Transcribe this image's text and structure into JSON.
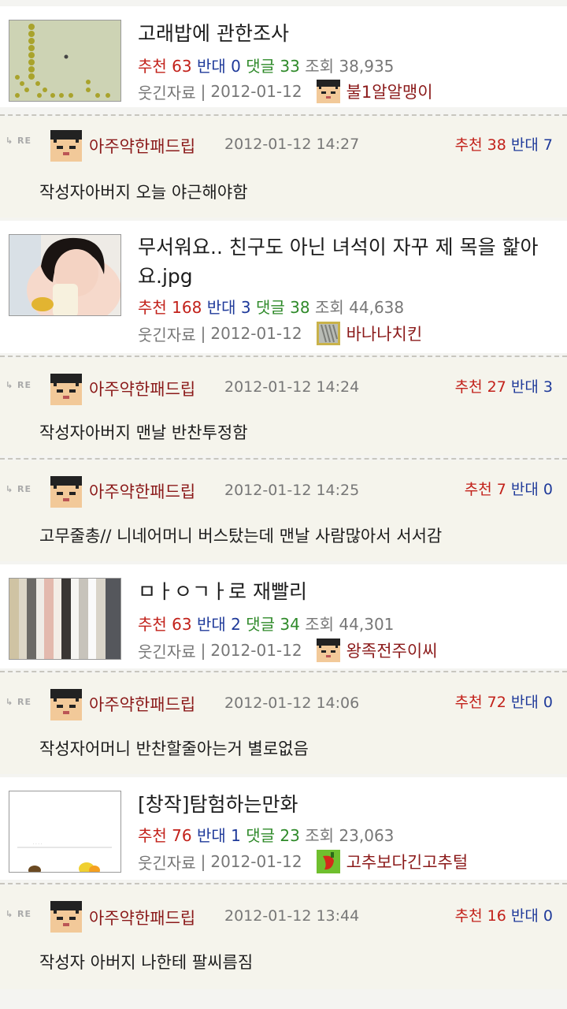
{
  "labels": {
    "recommend": "추천",
    "oppose": "반대",
    "comments": "댓글",
    "views": "조회",
    "re": "RE"
  },
  "colors": {
    "recommend": "#c2211a",
    "oppose": "#1f3a9a",
    "comments": "#2f8a2a",
    "author": "#8b1a1a"
  },
  "posts": [
    {
      "title": "고래밥에 관한조사",
      "recommend": "63",
      "oppose": "0",
      "comments": "33",
      "views": "38,935",
      "category": "웃긴자료",
      "date": "2012-01-12",
      "author": "불1알알맹이",
      "thumb_icon": "dot-grid-thumbnail",
      "avatar_icon": "pixel-face-avatar"
    },
    {
      "title": "무서워요.. 친구도 아닌 녀석이 자꾸 제 목을 핥아요.jpg",
      "recommend": "168",
      "oppose": "3",
      "comments": "38",
      "views": "44,638",
      "category": "웃긴자료",
      "date": "2012-01-12",
      "author": "바나나치킨",
      "thumb_icon": "girl-photo-thumbnail",
      "avatar_icon": "striped-tile-avatar"
    },
    {
      "title": "ㅁㅏㅇㄱㅏ로 재빨리",
      "recommend": "63",
      "oppose": "2",
      "comments": "34",
      "views": "44,301",
      "category": "웃긴자료",
      "date": "2012-01-12",
      "author": "왕족전주이씨",
      "thumb_icon": "vertical-stripes-thumbnail",
      "avatar_icon": "pixel-face-avatar"
    },
    {
      "title": "[창작]탐험하는만화",
      "recommend": "76",
      "oppose": "1",
      "comments": "23",
      "views": "23,063",
      "category": "웃긴자료",
      "date": "2012-01-12",
      "author": "고추보다긴고추털",
      "thumb_icon": "comic-thumbnail",
      "avatar_icon": "pepper-avatar"
    }
  ],
  "replies": [
    {
      "author": "아주약한패드립",
      "datetime": "2012-01-12 14:27",
      "recommend": "38",
      "oppose": "7",
      "text": "작성자아버지 오늘 야근해야함"
    },
    {
      "author": "아주약한패드립",
      "datetime": "2012-01-12 14:24",
      "recommend": "27",
      "oppose": "3",
      "text": "작성자아버지 맨날 반찬투정함"
    },
    {
      "author": "아주약한패드립",
      "datetime": "2012-01-12 14:25",
      "recommend": "7",
      "oppose": "0",
      "text": "고무줄총// 니네어머니 버스탔는데 맨날 사람많아서 서서감"
    },
    {
      "author": "아주약한패드립",
      "datetime": "2012-01-12 14:06",
      "recommend": "72",
      "oppose": "0",
      "text": "작성자어머니 반찬할줄아는거 별로없음"
    },
    {
      "author": "아주약한패드립",
      "datetime": "2012-01-12 13:44",
      "recommend": "16",
      "oppose": "0",
      "text": "작성자 아버지 나한테 팔씨름짐"
    }
  ]
}
